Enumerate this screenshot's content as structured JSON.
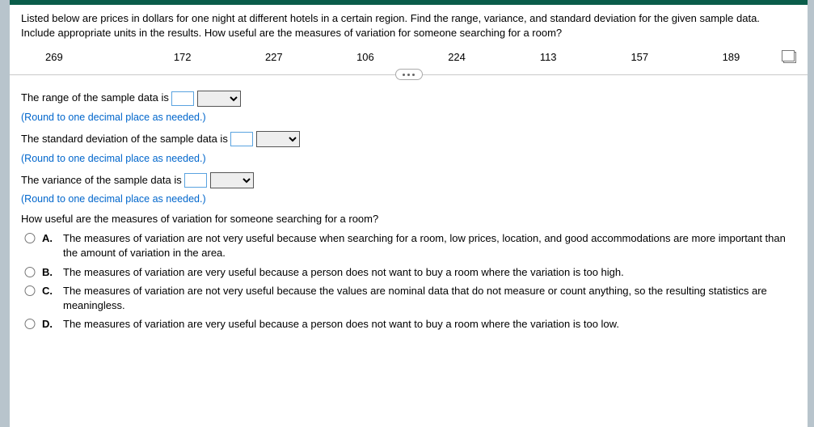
{
  "prompt": "Listed below are prices in dollars for one night at different hotels in a certain region. Find the range, variance, and standard deviation for the given sample data. Include appropriate units in the results. How useful are the measures of variation for someone searching for a room?",
  "data_values": [
    "269",
    "172",
    "227",
    "106",
    "224",
    "113",
    "157",
    "189"
  ],
  "range": {
    "label_before": "The range of the sample data is ",
    "value": "",
    "hint": "(Round to one decimal place as needed.)"
  },
  "stddev": {
    "label_before": "The standard deviation of the sample data is ",
    "value": "",
    "hint": "(Round to one decimal place as needed.)"
  },
  "variance": {
    "label_before": "The variance of the sample data is ",
    "value": "",
    "hint": "(Round to one decimal place as needed.)"
  },
  "mc": {
    "question": "How useful are the measures of variation for someone searching for a room?",
    "options": [
      {
        "letter": "A.",
        "text": "The measures of variation are not very useful because when searching for a room, low prices, location, and good accommodations are more important than the amount of variation in the area."
      },
      {
        "letter": "B.",
        "text": "The measures of variation are very useful because a person does not want to buy a room where the variation is too high."
      },
      {
        "letter": "C.",
        "text": "The measures of variation are not very useful because the values are nominal data that do not measure or count anything, so the resulting statistics are meaningless."
      },
      {
        "letter": "D.",
        "text": "The measures of variation are very useful because a person does not want to buy a room where the variation is too low."
      }
    ]
  }
}
